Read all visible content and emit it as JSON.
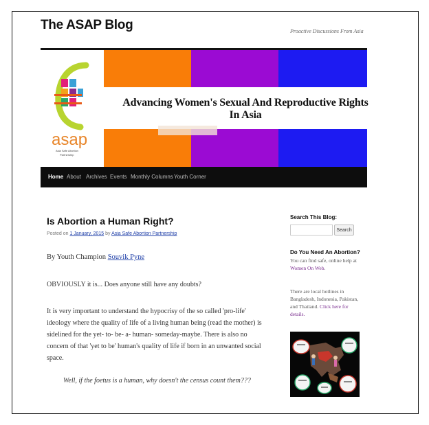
{
  "site": {
    "title": "The ASAP Blog",
    "tagline": "Proactive Discussions From Asia"
  },
  "banner": {
    "headline": "Advancing Women's Sexual And Reproductive Rights In Asia",
    "logo_text": "asap",
    "logo_subtext": "Asia Safe Abortion Partnership"
  },
  "nav": {
    "items": [
      "Home",
      "About",
      "Archives",
      "Events",
      "Monthly Columns",
      "Youth Corner"
    ]
  },
  "post": {
    "title": "Is Abortion a Human Right?",
    "meta_prefix": "Posted on ",
    "date": "1 January, 2015",
    "meta_by": " by ",
    "author": "Asia Safe Abortion Partnership",
    "byline_prefix": "By Youth Champion ",
    "byline_name": "Souvik Pyne",
    "para1": "OBVIOUSLY it is... Does anyone still have any doubts?",
    "para2": "It is very important to understand the hypocrisy of the so called 'pro-life' ideology where the quality of life of a living human being (read the mother) is sidelined for the yet- to- be- a- human- someday-maybe. There is also no concern of that 'yet to be' human's quality of life if born in an unwanted social space.",
    "quote": "Well, if the foetus is a human, why doesn't the census count them???"
  },
  "sidebar": {
    "search_heading": "Search This Blog:",
    "search_button": "Search",
    "abortion_heading": "Do You Need An Abortion?",
    "abortion_text": "You can find safe, online help at ",
    "abortion_link": "Women On Web",
    "abortion_end": ".",
    "hotline_text": "There are local hotlines in Bangladesh, Indonesia, Pakistan, and Thailand. ",
    "hotline_link": "Click here for details."
  },
  "colors": {
    "orange": "#f97d08",
    "purple": "#9b0bd3",
    "blue": "#1d1bf2",
    "nav_bg": "#0d0d0d"
  }
}
